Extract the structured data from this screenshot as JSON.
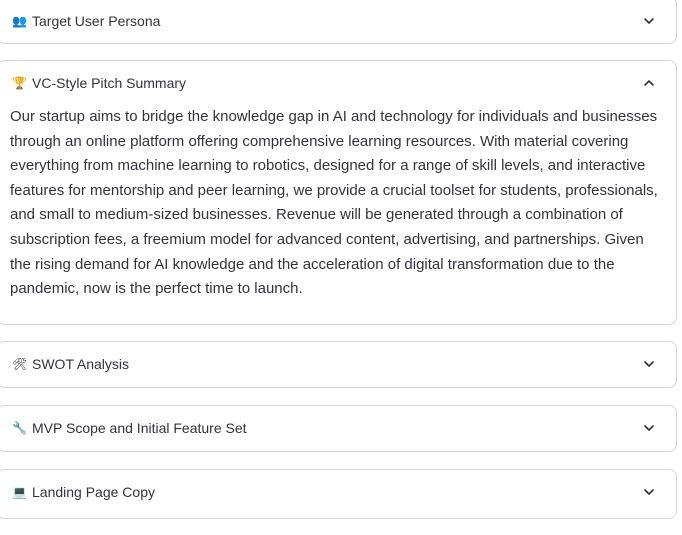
{
  "expanders": [
    {
      "icon": "👥",
      "icon_name": "busts-in-silhouette-icon",
      "title": "Target User Persona",
      "expanded": false
    },
    {
      "icon": "🏆",
      "icon_name": "trophy-icon",
      "title": "VC-Style Pitch Summary",
      "expanded": true,
      "body": "Our startup aims to bridge the knowledge gap in AI and technology for individuals and businesses through an online platform offering comprehensive learning resources. With material covering everything from machine learning to robotics, designed for a range of skill levels, and interactive features for mentorship and peer learning, we provide a crucial toolset for students, professionals, and small to medium-sized businesses. Revenue will be generated through a combination of subscription fees, a freemium model for advanced content, advertising, and partnerships. Given the rising demand for AI knowledge and the acceleration of digital transformation due to the pandemic, now is the perfect time to launch."
    },
    {
      "icon": "🛠",
      "icon_name": "hammer-and-wrench-icon",
      "title": "SWOT Analysis",
      "expanded": false
    },
    {
      "icon": "🔧",
      "icon_name": "wrench-icon",
      "title": "MVP Scope and Initial Feature Set",
      "expanded": false
    },
    {
      "icon": "💻",
      "icon_name": "laptop-icon",
      "title": "Landing Page Copy",
      "expanded": false
    }
  ],
  "colors": {
    "border": "#d6d6d9",
    "text": "#31333f"
  }
}
